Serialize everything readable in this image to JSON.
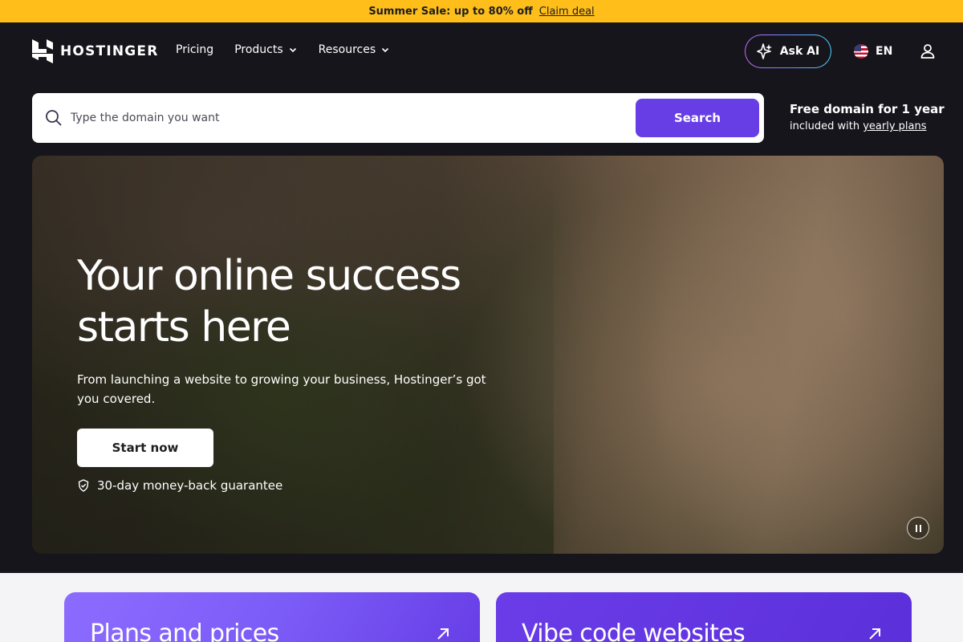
{
  "promo": {
    "text": "Summer Sale: up to 80% off",
    "link": "Claim deal",
    "bg_color": "#ffbe1a"
  },
  "nav": {
    "logo": "HOSTINGER",
    "links": [
      {
        "label": "Pricing",
        "has_dropdown": false
      },
      {
        "label": "Products",
        "has_dropdown": true
      },
      {
        "label": "Resources",
        "has_dropdown": true
      }
    ],
    "ask_ai": "Ask AI",
    "language": "EN"
  },
  "search": {
    "placeholder": "Type the domain you want",
    "button": "Search",
    "free_domain_title": "Free domain for 1 year",
    "free_domain_prefix": "included with ",
    "free_domain_link": "yearly plans",
    "accent_color": "#673de6"
  },
  "hero": {
    "title_line1": "Your online success",
    "title_line2": "starts here",
    "subtitle": "From launching a website to growing your business, Hostinger’s got you covered.",
    "cta": "Start now",
    "guarantee": "30-day money-back guarantee"
  },
  "cards": [
    {
      "title": "Plans and prices"
    },
    {
      "title": "Vibe code websites"
    }
  ]
}
